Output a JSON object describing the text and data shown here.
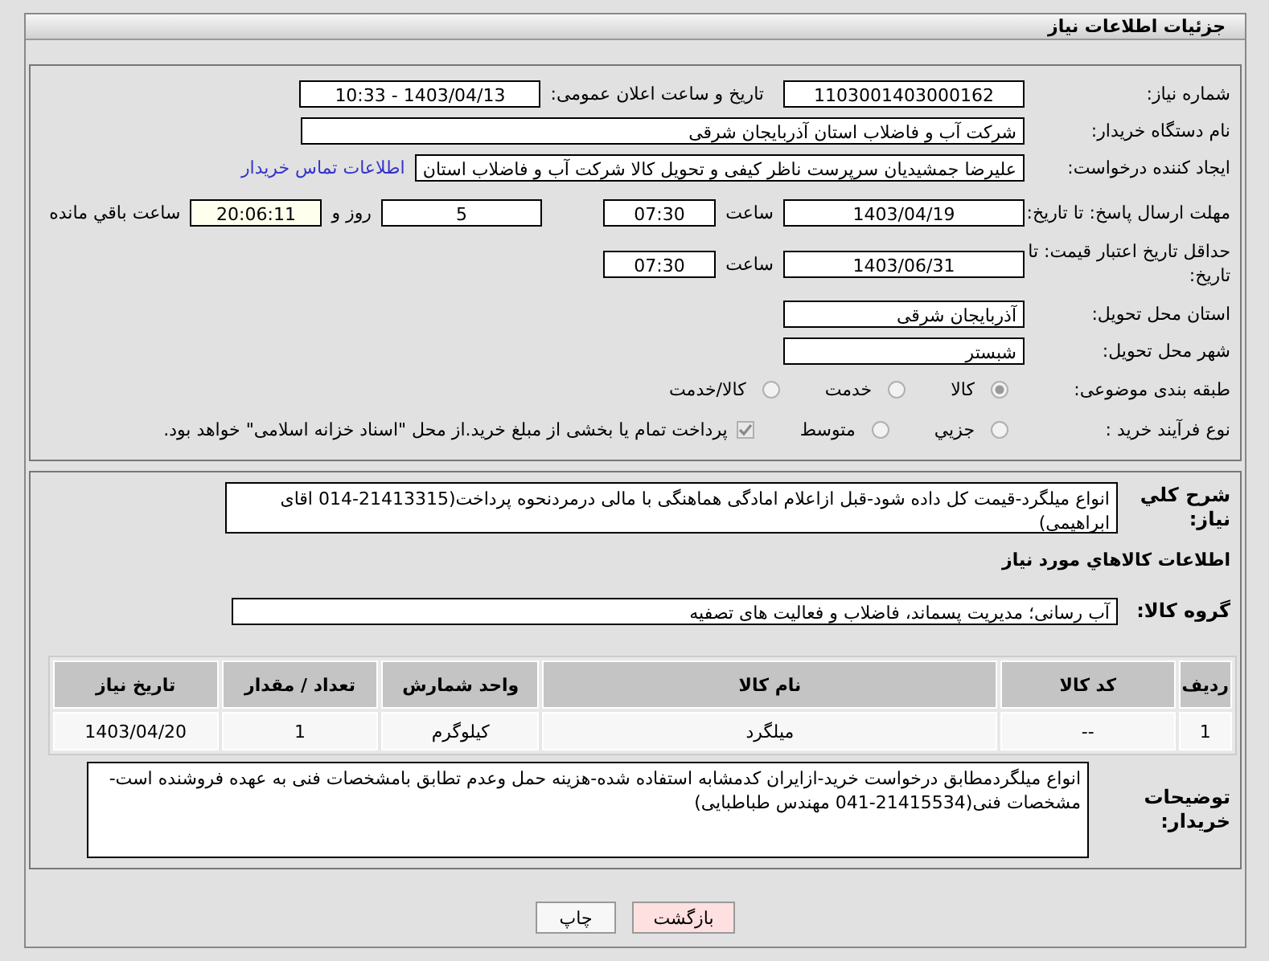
{
  "page_title": "جزئیات اطلاعات نیاز",
  "need_number": {
    "label": "شماره نیاز:",
    "value": "1103001403000162"
  },
  "announce": {
    "label": "تاریخ و ساعت اعلان عمومی:",
    "value": "1403/04/13 - 10:33"
  },
  "buyer": {
    "label": "نام دستگاه خریدار:",
    "value": "شرکت آب و فاضلاب استان آذربایجان شرقی"
  },
  "creator": {
    "label": "ایجاد کننده درخواست:",
    "value": "علیرضا جمشیدیان سرپرست ناظر کیفی و تحویل کالا شرکت آب و فاضلاب استان",
    "link": "اطلاعات تماس خریدار"
  },
  "deadline": {
    "label": "مهلت ارسال پاسخ: تا تاریخ:",
    "date": "1403/04/19",
    "time_label": "ساعت",
    "time": "07:30",
    "days": "5",
    "days_label": "روز و",
    "remaining": "20:06:11",
    "remaining_label": "ساعت باقي مانده"
  },
  "price_validity": {
    "label": "حداقل تاریخ اعتبار قیمت: تا تاریخ:",
    "date": "1403/06/31",
    "time_label": "ساعت",
    "time": "07:30"
  },
  "province": {
    "label": "استان محل تحویل:",
    "value": "آذربایجان شرقی"
  },
  "city": {
    "label": "شهر محل تحویل:",
    "value": "شبستر"
  },
  "category": {
    "label": "طبقه بندی موضوعی:",
    "options": [
      {
        "label": "کالا",
        "selected": true
      },
      {
        "label": "خدمت",
        "selected": false
      },
      {
        "label": "کالا/خدمت",
        "selected": false
      }
    ]
  },
  "purchase_type": {
    "label": "نوع فرآیند خرید :",
    "options": [
      {
        "label": "جزیي",
        "selected": false
      },
      {
        "label": "متوسط",
        "selected": false
      }
    ],
    "treasury": {
      "checked": true,
      "text": "پرداخت تمام یا بخشی از مبلغ خرید.از محل \"اسناد خزانه اسلامی\" خواهد بود."
    }
  },
  "description": {
    "label": "شرح کلي نیاز:",
    "value": "انواع میلگرد-قیمت کل داده شود-قبل ازاعلام امادگی هماهنگی با مالی درمردنحوه پرداخت(21413315-014 اقای ابراهیمی)"
  },
  "goods_heading": "اطلاعات کالاهاي مورد نیاز",
  "goods_group": {
    "label": "گروه کالا:",
    "value": "آب رسانی؛ مدیریت پسماند، فاضلاب و فعالیت های تصفیه"
  },
  "table": {
    "columns": [
      "ردیف",
      "کد کالا",
      "نام کالا",
      "واحد شمارش",
      "تعداد / مقدار",
      "تاریخ نیاز"
    ],
    "rows": [
      [
        "1",
        "--",
        "میلگرد",
        "کیلوگرم",
        "1",
        "1403/04/20"
      ]
    ]
  },
  "buyer_notes": {
    "label": "توضیحات خریدار:",
    "value": "انواع میلگردمطابق درخواست خرید-ازایران کدمشابه استفاده شده-هزینه حمل وعدم تطابق بامشخصات فنی به عهده فروشنده است-مشخصات فنی(21415534-041 مهندس طباطبایی)"
  },
  "buttons": [
    {
      "label": "بازگشت",
      "kind": "back"
    },
    {
      "label": "چاپ",
      "kind": "print"
    }
  ]
}
